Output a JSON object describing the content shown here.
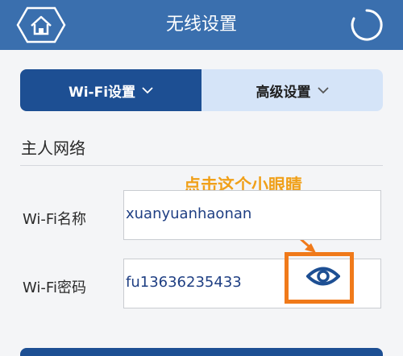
{
  "header": {
    "title": "无线设置",
    "home_icon": "home-icon",
    "refresh_icon": "refresh-icon"
  },
  "tabs": [
    {
      "label": "Wi-Fi设置",
      "active": true
    },
    {
      "label": "高级设置",
      "active": false
    }
  ],
  "section": {
    "title": "主人网络"
  },
  "annotation": {
    "text": "点击这个小眼睛",
    "color": "#f0a019",
    "highlight_color": "#f07a1a"
  },
  "fields": {
    "name_label": "Wi-Fi名称",
    "name_value": "xuanyuanhaonan",
    "password_label": "Wi-Fi密码",
    "password_value": "fu13636235433",
    "eye_icon": "eye-icon"
  },
  "colors": {
    "header": "#3a6fae",
    "tab_active": "#1d4f93",
    "tab_inactive": "#d5e4f8",
    "value_text": "#1f3f83"
  }
}
